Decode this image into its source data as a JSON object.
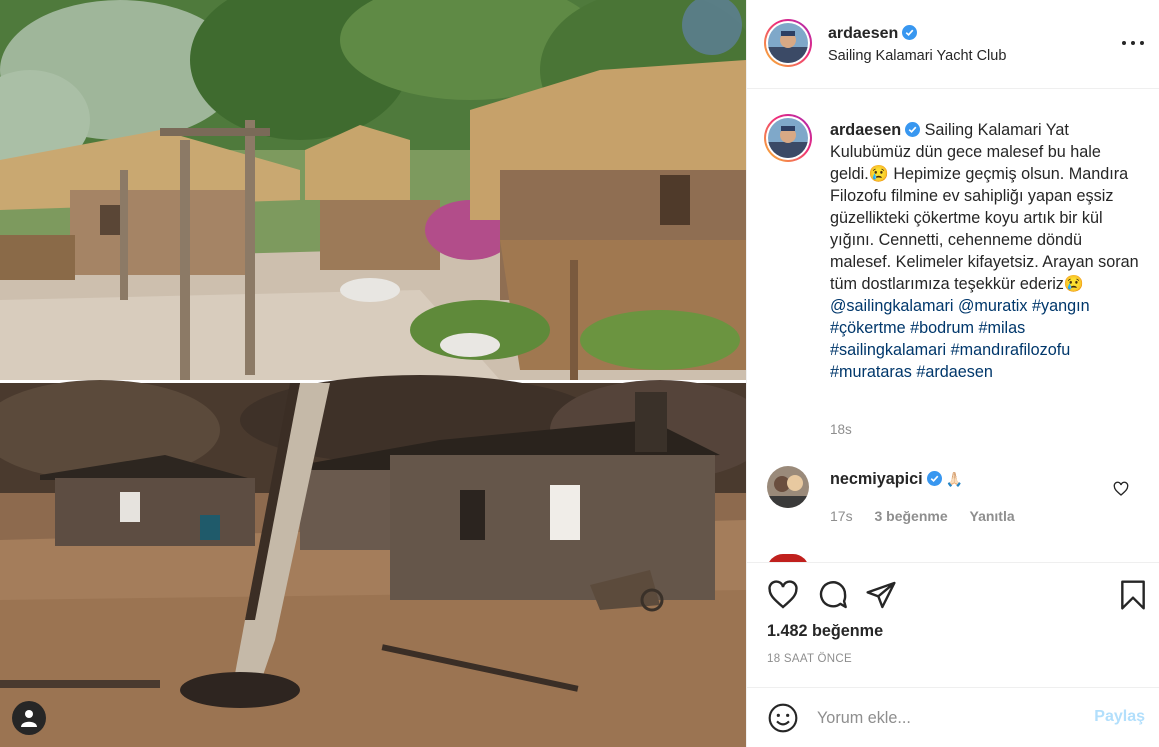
{
  "post": {
    "username": "ardaesen",
    "location": "Sailing Kalamari Yacht Club",
    "caption": {
      "text_1": "Sailing Kalamari Yat Kulubümüz dün gece malesef bu hale geldi.",
      "emoji_1": "😢",
      "text_2": " Hepimize geçmiş olsun. Mandıra Filozofu filmine ev sahipliğı yapan eşsiz güzellikteki çökertme koyu artık bir kül yığını. Cennetti, cehenneme döndü malesef. Kelimeler kifayetsiz. Arayan soran tüm dostlarımıza teşekkür ederiz",
      "emoji_2": "😢",
      "tags": [
        "@sailingkalamari",
        "@muratix",
        "#yangın",
        "#çökertme",
        "#bodrum",
        "#milas",
        "#sailingkalamari",
        "#mandırafilozofu",
        "#murataras",
        "#ardaesen"
      ]
    },
    "caption_time": "18s",
    "likes": "1.482 beğenme",
    "posted_ago": "18 SAAT ÖNCE"
  },
  "comment": {
    "username": "necmiyapici",
    "text": "🙏🏻",
    "time": "17s",
    "likes": "3 beğenme",
    "reply": "Yanıtla"
  },
  "add_comment": {
    "placeholder": "Yorum ekle...",
    "post_label": "Paylaş"
  },
  "icons": {
    "verified": "verified-badge-icon",
    "more": "more-options-icon",
    "like": "heart-icon",
    "comment": "comment-bubble-icon",
    "share": "paper-plane-icon",
    "save": "bookmark-icon",
    "emoji": "emoji-smiley-icon",
    "tagged_users": "user-tag-icon"
  },
  "colors": {
    "verified_blue": "#3897f0",
    "link_blue": "#00376b",
    "post_button_disabled": "#b2dffc"
  }
}
